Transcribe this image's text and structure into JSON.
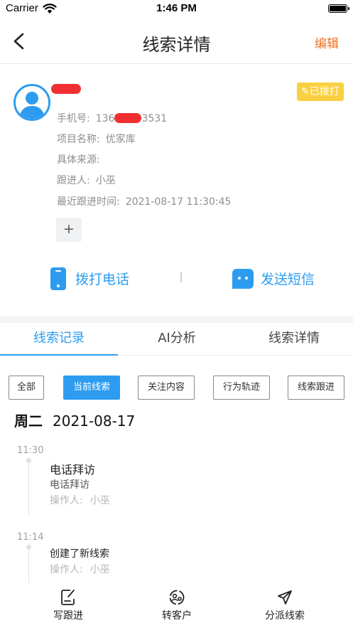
{
  "status_bar": {
    "carrier": "Carrier",
    "time": "1:46 PM"
  },
  "nav": {
    "title": "线索详情",
    "edit_label": "编辑"
  },
  "profile": {
    "badge": "✎已拨打",
    "phone_label": "手机号:",
    "phone_prefix": "136",
    "phone_suffix": "3531",
    "project_label": "项目名称:",
    "project_value": "优家库",
    "source_label": "具体来源:",
    "source_value": "",
    "follower_label": "跟进人:",
    "follower_value": "小巫",
    "last_follow_label": "最近跟进时间:",
    "last_follow_value": "2021-08-17 11:30:45",
    "add_label": "+"
  },
  "actions": {
    "call_label": "拨打电话",
    "sms_label": "发送短信"
  },
  "tabs": [
    {
      "label": "线索记录"
    },
    {
      "label": "AI分析"
    },
    {
      "label": "线索详情"
    }
  ],
  "filters": [
    {
      "label": "全部"
    },
    {
      "label": "当前线索"
    },
    {
      "label": "关注内容"
    },
    {
      "label": "行为轨迹"
    },
    {
      "label": "线索跟进"
    }
  ],
  "date_group": {
    "weekday": "周二",
    "date": "2021-08-17"
  },
  "timeline": [
    {
      "time": "11:30",
      "title": "电话拜访",
      "subtitle": "电话拜访",
      "operator_label": "操作人:",
      "operator": "小巫"
    },
    {
      "time": "11:14",
      "title": "创建了新线索",
      "operator_label": "操作人:",
      "operator": "小巫"
    }
  ],
  "bottom_bar": [
    {
      "label": "写跟进",
      "icon": "edit-icon"
    },
    {
      "label": "转客户",
      "icon": "convert-icon"
    },
    {
      "label": "分派线索",
      "icon": "send-icon"
    }
  ],
  "colors": {
    "accent": "#2d9cf0",
    "edit": "#f07020",
    "badge": "#f8d040"
  }
}
